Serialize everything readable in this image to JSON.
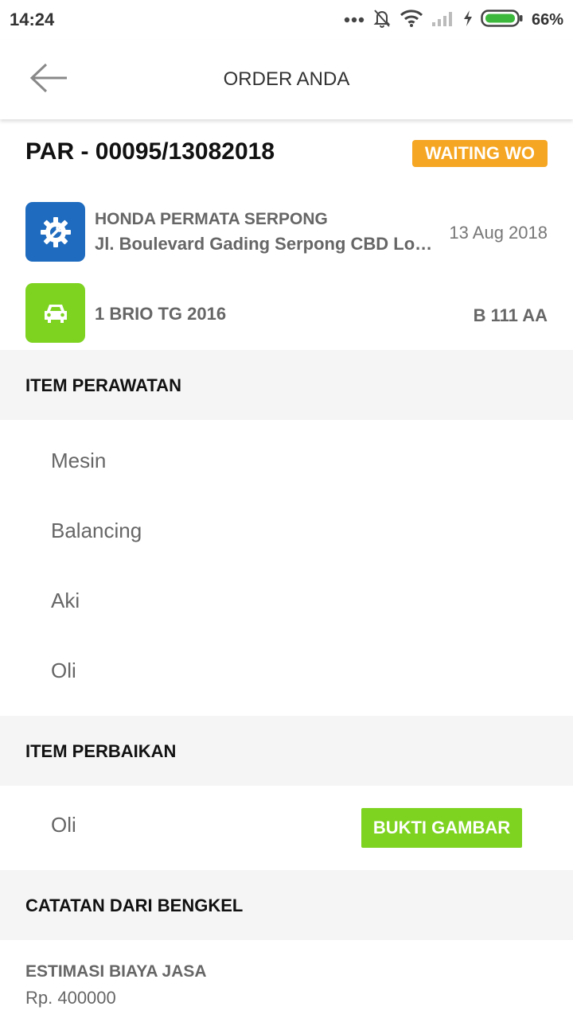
{
  "status_bar": {
    "time": "14:24",
    "battery_percent": "66%",
    "icons": [
      "more-dots-icon",
      "bell-off-icon",
      "wifi-icon",
      "signal-icon",
      "charging-icon",
      "battery-icon"
    ]
  },
  "app_bar": {
    "back_icon": "arrow-left-icon",
    "title": "ORDER ANDA"
  },
  "order": {
    "id": "PAR - 00095/13082018",
    "status": "WAITING WO",
    "status_color": "#f5a623"
  },
  "shop": {
    "icon": "gear-wrench-icon",
    "icon_color": "#1e6bbf",
    "name": "HONDA PERMATA SERPONG",
    "address": "Jl. Boulevard Gading Serpong CBD Lot....",
    "date": "13 Aug 2018"
  },
  "car": {
    "icon": "car-icon",
    "icon_color": "#7ed321",
    "name": "1 BRIO TG 2016",
    "plate": "B 111 AA"
  },
  "maintenance": {
    "title": "ITEM PERAWATAN",
    "items": [
      "Mesin",
      "Balancing",
      "Aki",
      "Oli"
    ]
  },
  "repair": {
    "title": "ITEM PERBAIKAN",
    "items": [
      {
        "label": "Oli",
        "button": "BUKTI GAMBAR"
      }
    ],
    "button_color": "#7ed321"
  },
  "notes": {
    "title": "CATATAN DARI BENGKEL",
    "estimate_label": "ESTIMASI BIAYA JASA",
    "estimate_value": "Rp. 400000"
  }
}
